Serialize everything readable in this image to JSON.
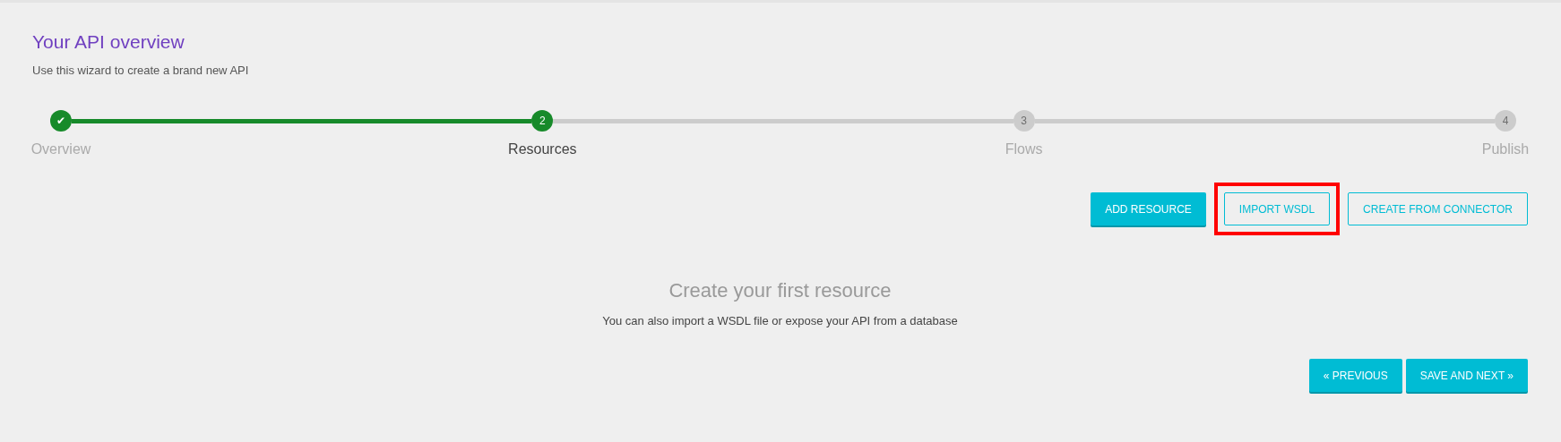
{
  "header": {
    "title": "Your API overview",
    "subtitle": "Use this wizard to create a brand new API"
  },
  "steps": [
    {
      "marker": "✔",
      "label": "Overview",
      "selected": false
    },
    {
      "marker": "2",
      "label": "Resources",
      "selected": true
    },
    {
      "marker": "3",
      "label": "Flows",
      "selected": false
    },
    {
      "marker": "4",
      "label": "Publish",
      "selected": false
    }
  ],
  "actions": [
    {
      "label": "ADD RESOURCE",
      "kind": "filled",
      "highlighted": false
    },
    {
      "label": "IMPORT WSDL",
      "kind": "outlined",
      "highlighted": true
    },
    {
      "label": "CREATE FROM CONNECTOR",
      "kind": "outlined",
      "highlighted": false
    }
  ],
  "empty_state": {
    "title": "Create your first resource",
    "text": "You can also import a WSDL file or expose your API from a database"
  },
  "navigation": [
    {
      "label": "« PREVIOUS"
    },
    {
      "label": "SAVE AND NEXT »"
    }
  ]
}
